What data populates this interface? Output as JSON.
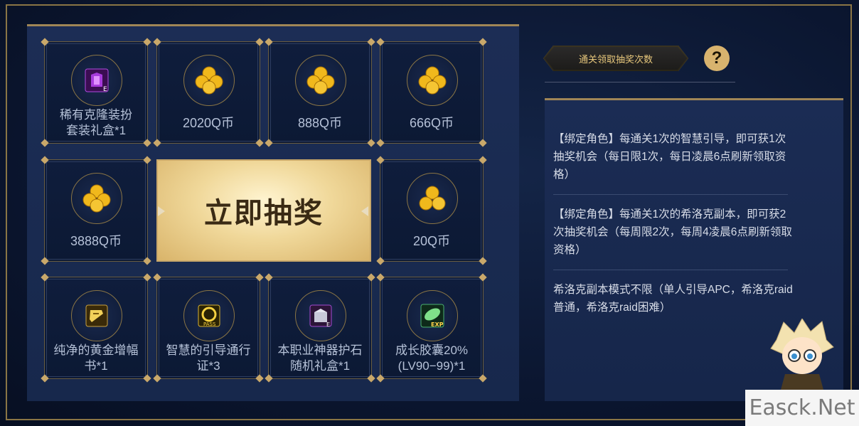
{
  "prizes": {
    "r1c1": "稀有克隆装扮\n套装礼盒*1",
    "r1c2": "2020Q币",
    "r1c3": "888Q币",
    "r1c4": "666Q币",
    "r2c1": "3888Q币",
    "r2c4": "20Q币",
    "r3c1": "纯净的黄金增幅\n书*1",
    "r3c2": "智慧的引导通行\n证*3",
    "r3c3": "本职业神器护石\n随机礼盒*1",
    "r3c4": "成长胶囊20%\n(LV90−99)*1"
  },
  "draw_button": "立即抽奖",
  "draw_count_button": "通关领取抽奖次数",
  "help_symbol": "?",
  "rules": [
    "【绑定角色】每通关1次的智慧引导，即可获1次抽奖机会（每日限1次，每日凌晨6点刷新领取资格）",
    "【绑定角色】每通关1次的希洛克副本，即可获2次抽奖机会（每周限2次，每周4凌晨6点刷新领取资格）",
    "希洛克副本模式不限（单人引导APC，希洛克raid普通，希洛克raid困难）"
  ],
  "watermark": "Easck.Net",
  "icon_badges": {
    "equip": "E",
    "exp": "EXP",
    "pass": "PASS"
  }
}
